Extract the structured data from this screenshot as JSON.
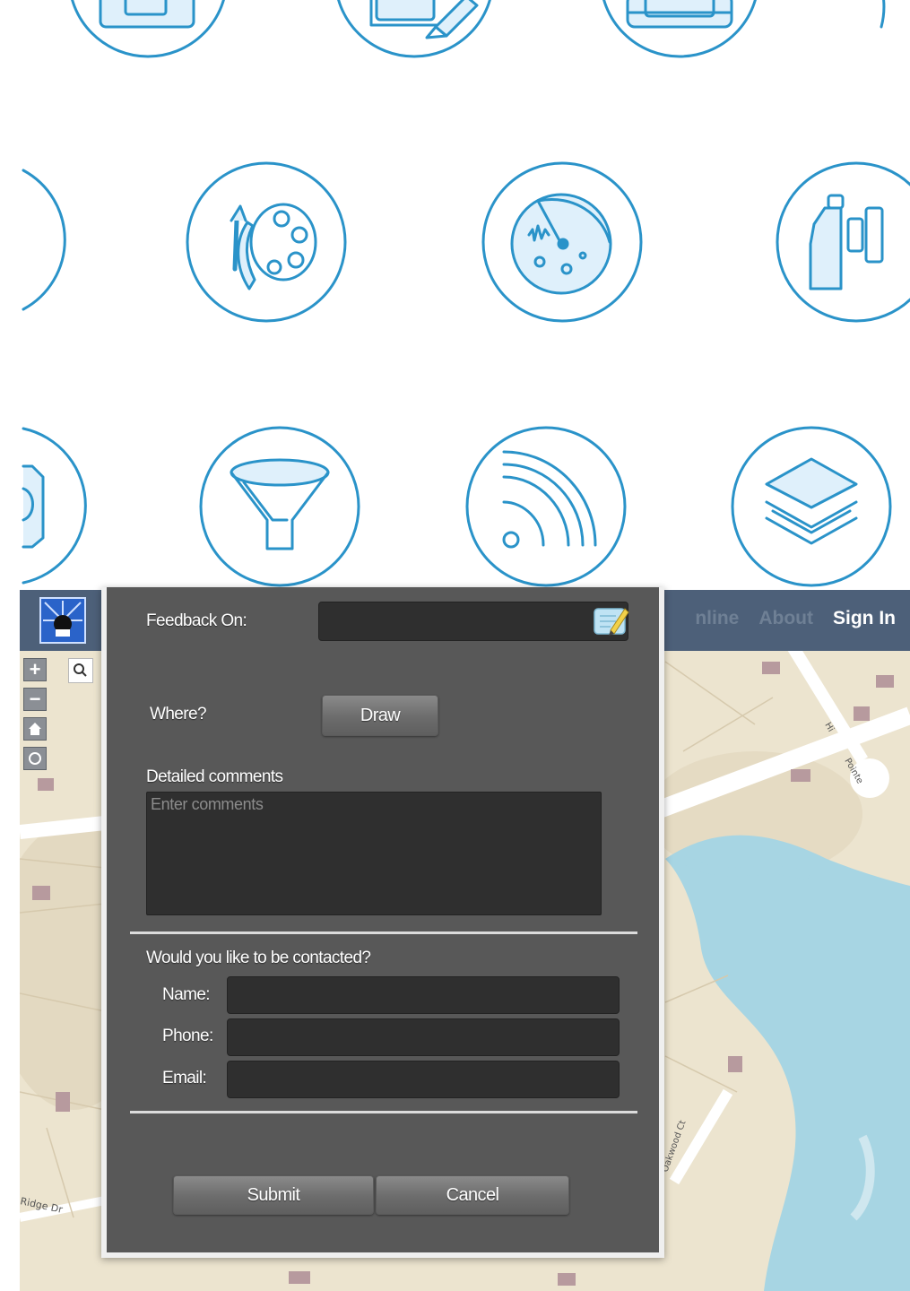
{
  "header": {
    "nav": [
      "nline",
      "About",
      "Sign In"
    ],
    "colors": {
      "bar": "#4d6079",
      "nav_dim": "#6f8095",
      "nav_active": "#ffffff"
    }
  },
  "icons": [
    "tablet-icon",
    "edit-document-icon",
    "toolbox-icon",
    "palette-icon",
    "radar-icon",
    "binoculars-icon",
    "ticket-icon",
    "funnel-icon",
    "rss-icon",
    "layers-icon"
  ],
  "map_controls": [
    "zoom-in",
    "zoom-out",
    "home",
    "locate"
  ],
  "map": {
    "street_labels": [
      "Ridge Dr",
      "Pointe",
      "Hi",
      "Oakwood Ct"
    ]
  },
  "dialog": {
    "feedback_on_label": "Feedback On:",
    "where_label": "Where?",
    "draw_button": "Draw",
    "comments_label": "Detailed comments",
    "comments_placeholder": "Enter comments",
    "contact_question": "Would you like to be contacted?",
    "name_label": "Name:",
    "phone_label": "Phone:",
    "email_label": "Email:",
    "submit_button": "Submit",
    "cancel_button": "Cancel"
  },
  "colors": {
    "icon_stroke": "#2a93c9",
    "dialog_bg": "#585858",
    "field_bg": "#2f2f2f",
    "water": "#a7d5e3",
    "land": "#ece4cf"
  }
}
